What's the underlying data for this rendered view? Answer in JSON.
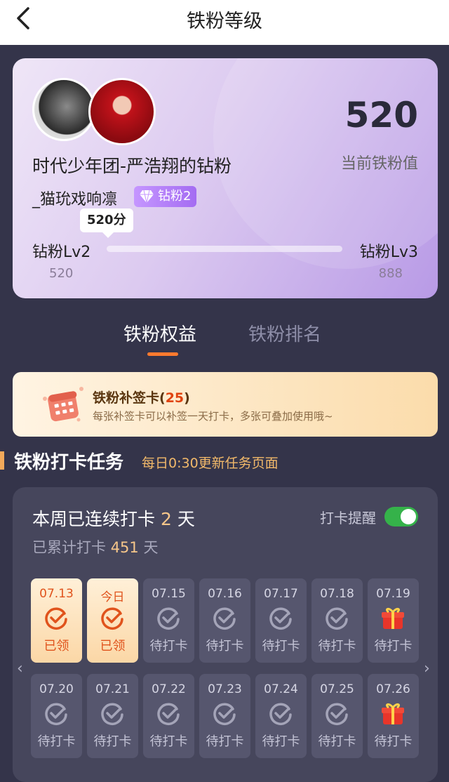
{
  "header": {
    "title": "铁粉等级"
  },
  "fan_card": {
    "score": "520",
    "score_label": "当前铁粉值",
    "group_name": "时代少年团-严浩翔的钻粉",
    "user_name": "_猫玧戏响凛",
    "badge_label": "钻粉2",
    "tooltip": "520分",
    "level_current": "钻粉Lv2",
    "level_next": "钻粉Lv3",
    "value_current": "520",
    "value_next": "888",
    "progress_fraction": 0.0
  },
  "tabs": [
    {
      "label": "铁粉权益"
    },
    {
      "label": "铁粉排名"
    }
  ],
  "banner": {
    "title": "铁粉补签卡",
    "count": "25",
    "subtitle": "每张补签卡可以补签一天打卡，多张可叠加使用哦~"
  },
  "section": {
    "title": "铁粉打卡任务",
    "subtitle": "每日0:30更新任务页面"
  },
  "checkin": {
    "streak_prefix": "本周已连续打卡",
    "streak_days": "2",
    "streak_suffix": "天",
    "total_prefix": "已累计打卡",
    "total_days": "451",
    "total_suffix": "天",
    "remind_label": "打卡提醒",
    "remind_on": true,
    "days": [
      {
        "date": "07.13",
        "status": "已领",
        "done": true,
        "icon": "check-icon"
      },
      {
        "date": "今日",
        "status": "已领",
        "done": true,
        "icon": "check-icon"
      },
      {
        "date": "07.15",
        "status": "待打卡",
        "done": false,
        "icon": "check-icon"
      },
      {
        "date": "07.16",
        "status": "待打卡",
        "done": false,
        "icon": "check-icon"
      },
      {
        "date": "07.17",
        "status": "待打卡",
        "done": false,
        "icon": "check-icon"
      },
      {
        "date": "07.18",
        "status": "待打卡",
        "done": false,
        "icon": "check-icon"
      },
      {
        "date": "07.19",
        "status": "待打卡",
        "done": false,
        "icon": "gift-icon"
      },
      {
        "date": "07.20",
        "status": "待打卡",
        "done": false,
        "icon": "check-icon"
      },
      {
        "date": "07.21",
        "status": "待打卡",
        "done": false,
        "icon": "check-icon"
      },
      {
        "date": "07.22",
        "status": "待打卡",
        "done": false,
        "icon": "check-icon"
      },
      {
        "date": "07.23",
        "status": "待打卡",
        "done": false,
        "icon": "check-icon"
      },
      {
        "date": "07.24",
        "status": "待打卡",
        "done": false,
        "icon": "check-icon"
      },
      {
        "date": "07.25",
        "status": "待打卡",
        "done": false,
        "icon": "check-icon"
      },
      {
        "date": "07.26",
        "status": "待打卡",
        "done": false,
        "icon": "gift-icon"
      }
    ]
  },
  "colors": {
    "accent": "#ff7a2e",
    "toggle": "#35b24a",
    "highlight": "#f6c68a"
  }
}
